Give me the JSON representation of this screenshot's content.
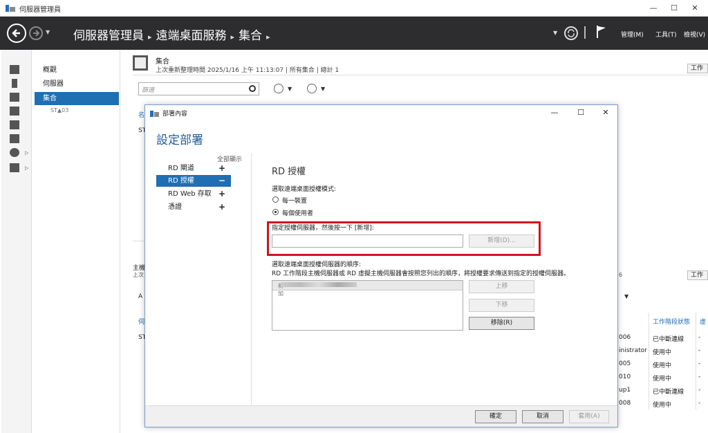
{
  "window": {
    "title": "伺服器管理員",
    "controls": {
      "minimize": "—",
      "maximize": "☐",
      "close": "✕"
    }
  },
  "header": {
    "breadcrumb": [
      "伺服器管理員",
      "遠端桌面服務",
      "集合"
    ],
    "menu": {
      "manage": "管理(M)",
      "tools": "工具(T)",
      "view": "檢視(V)"
    }
  },
  "nav": {
    "items": [
      {
        "label": "概觀"
      },
      {
        "label": "伺服器"
      },
      {
        "label": "集合"
      }
    ],
    "sub_item": "ST▲03"
  },
  "collection": {
    "title": "集合",
    "subtitle": "上次重新整理時間 2025/1/16 上午 11:13:07 | 所有集合 | 總計 1",
    "tasks_label": "工作",
    "filter_placeholder": "篩選",
    "name_col_fragment": "名",
    "row_fragment": "ST",
    "host_section_fragment": "主機",
    "host_sub_fragment": "上次",
    "host_count_fragment": "6",
    "host_tasks_label": "工作",
    "host_filter_fragment": "A",
    "host_col_fragment": "伺",
    "host_row_fragment": "ST",
    "host_table": {
      "headers": [
        "工作階段狀態",
        "虛"
      ],
      "rows": [
        {
          "user": "006",
          "state": "已中斷連線",
          "extra": "-"
        },
        {
          "user": "inistrator",
          "state": "使用中",
          "extra": "-"
        },
        {
          "user": "005",
          "state": "使用中",
          "extra": "-"
        },
        {
          "user": "010",
          "state": "使用中",
          "extra": "-"
        },
        {
          "user": "up1",
          "state": "已中斷連線",
          "extra": "-"
        },
        {
          "user": "008",
          "state": "使用中",
          "extra": "-"
        }
      ]
    }
  },
  "dialog": {
    "title": "部署內容",
    "heading": "設定部署",
    "show_all": "全部顯示",
    "nav": [
      {
        "label": "RD 閘道",
        "toggle": "+"
      },
      {
        "label": "RD 授權",
        "toggle": "−"
      },
      {
        "label": "RD Web 存取",
        "toggle": "+"
      },
      {
        "label": "憑證",
        "toggle": "+"
      }
    ],
    "section_title": "RD 授權",
    "mode_label": "選取遠端桌面授權模式:",
    "mode_options": [
      {
        "label": "每一裝置",
        "selected": false
      },
      {
        "label": "每個使用者",
        "selected": true
      }
    ],
    "server_label": "指定授權伺服器，然後按一下 [新增]:",
    "server_input": "",
    "add_button": "新增(D)...",
    "order_label": "選取遠端桌面授權伺服器的順序:",
    "order_desc": "RD 工作階段主機伺服器或 RD 虛擬主機伺服器會按照您列出的順序，將授權要求傳送到指定的授權伺服器。",
    "server_list": [
      "新加"
    ],
    "move_up": "上移",
    "move_down": "下移",
    "remove": "移除(R)",
    "ok": "確定",
    "cancel": "取消",
    "apply": "套用(A)"
  },
  "colors": {
    "header_bg": "#2d2d30",
    "accent": "#1f6fb3",
    "highlight_box": "#d0141b"
  }
}
